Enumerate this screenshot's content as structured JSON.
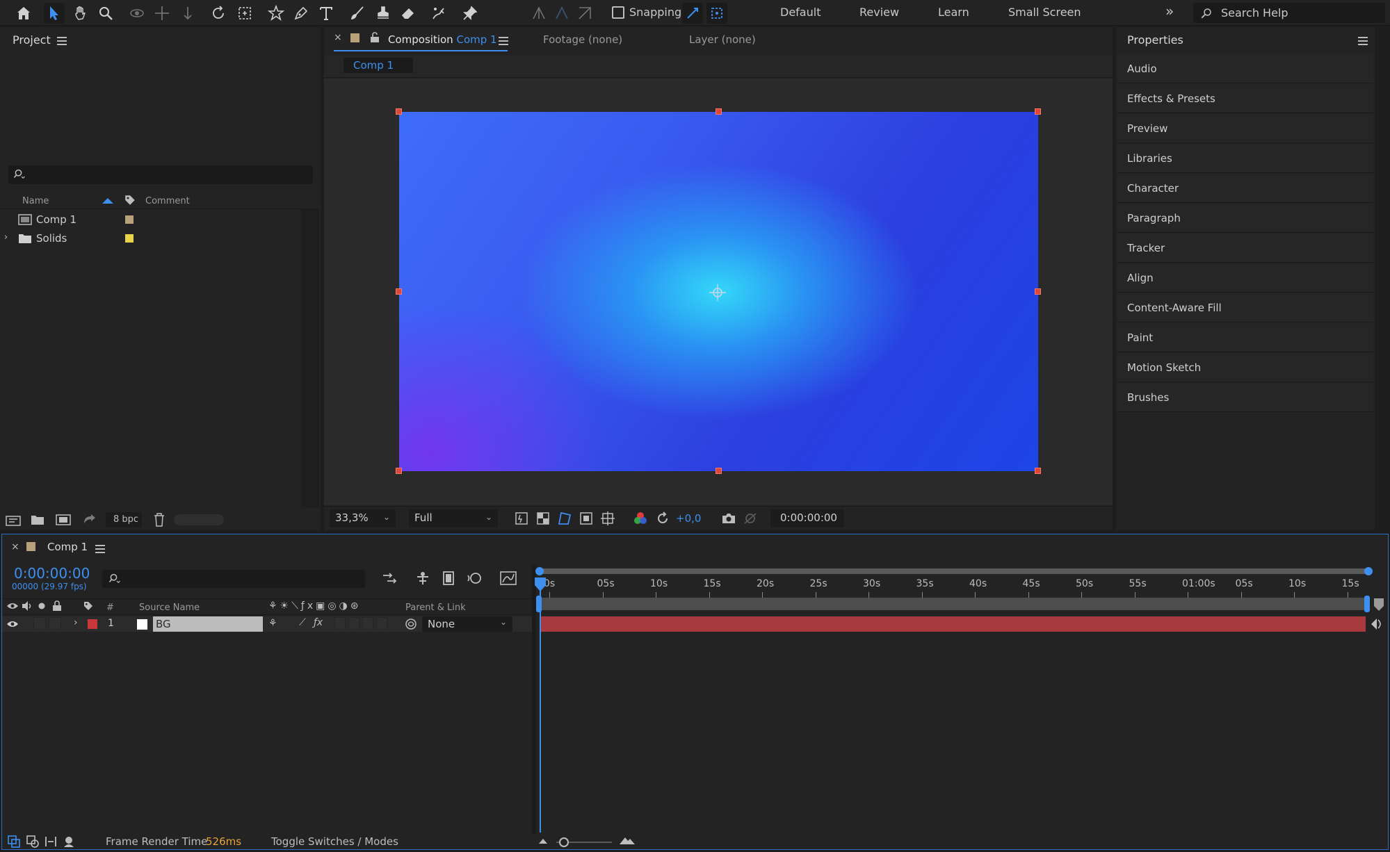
{
  "toolbar": {
    "tools": [
      "home-icon",
      "selection-arrow-icon",
      "hand-icon",
      "zoom-icon",
      "orbit-camera-icon",
      "pan-camera-icon",
      "dolly-camera-icon",
      "rotate-icon",
      "pan-behind-icon",
      "shape-star-icon",
      "pen-icon",
      "type-icon",
      "brush-icon",
      "clone-stamp-icon",
      "eraser-icon",
      "roto-brush-icon",
      "puppet-pin-icon"
    ],
    "snapping_label": "Snapping",
    "workspaces": [
      "Default",
      "Review",
      "Learn",
      "Small Screen"
    ],
    "overflow_icon": "double-chevron-icon",
    "search_placeholder": "Search Help"
  },
  "project": {
    "title": "Project",
    "search_placeholder": "",
    "columns": {
      "name": "Name",
      "comment": "Comment"
    },
    "items": [
      {
        "name": "Comp 1",
        "type": "composition",
        "label_color": "#b8a07a"
      },
      {
        "name": "Solids",
        "type": "folder",
        "label_color": "#e8d44a"
      }
    ],
    "footer": {
      "bit_depth": "8 bpc"
    }
  },
  "composition": {
    "close_label": "×",
    "tab_prefix": "Composition",
    "tab_name": "Comp 1",
    "footage_tab": "Footage (none)",
    "layer_tab": "Layer (none)",
    "breadcrumb": "Comp 1",
    "zoom": "33,3%",
    "resolution": "Full",
    "exposure": "+0,0",
    "timecode": "0:00:00:00"
  },
  "properties": {
    "title": "Properties",
    "items": [
      "Audio",
      "Effects & Presets",
      "Preview",
      "Libraries",
      "Character",
      "Paragraph",
      "Tracker",
      "Align",
      "Content-Aware Fill",
      "Paint",
      "Motion Sketch",
      "Brushes"
    ]
  },
  "timeline": {
    "close_label": "×",
    "comp_name": "Comp 1",
    "timecode": "0:00:00:00",
    "frame_info": "00000 (29.97 fps)",
    "columns": {
      "number": "#",
      "source_name": "Source Name",
      "parent": "Parent & Link"
    },
    "ruler": [
      "0s",
      "05s",
      "10s",
      "15s",
      "20s",
      "25s",
      "30s",
      "35s",
      "40s",
      "45s",
      "50s",
      "55s",
      "01:00s",
      "05s",
      "10s",
      "15s"
    ],
    "layers": [
      {
        "number": "1",
        "name": "BG",
        "parent": "None",
        "label_color": "#c8383a",
        "bar_color": "#a8393e"
      }
    ],
    "footer": {
      "render_label": "Frame Render Time",
      "render_value": "526ms",
      "toggle_label": "Toggle Switches / Modes"
    }
  },
  "colors": {
    "accent_blue": "#2d8ceb",
    "render_time": "#e8a23a",
    "handle_red": "#d9483a"
  }
}
